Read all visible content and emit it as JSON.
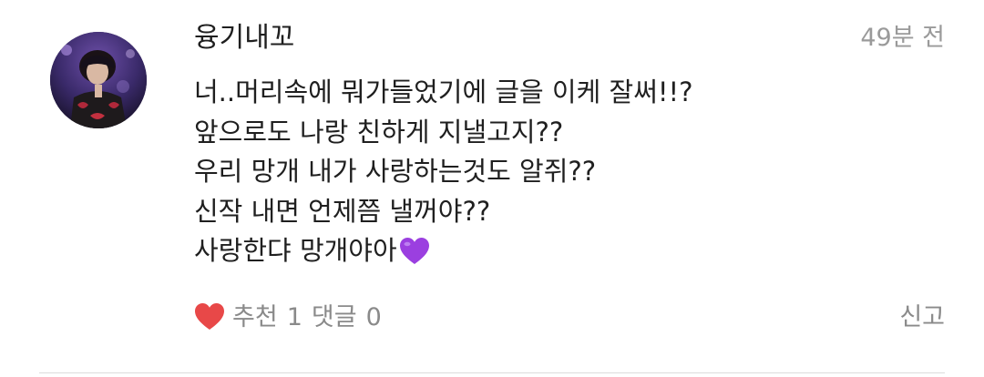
{
  "comment": {
    "username": "융기내꼬",
    "timestamp": "49분 전",
    "lines": [
      "너..머리속에 뭐가들었기에 글을 이케 잘써!!?",
      "앞으로도 나랑 친하게 지낼고지??",
      "우리 망개 내가 사랑하는것도 알쥐??",
      "신작 내면 언제쯤 낼꺼야??",
      "사랑한댜 망개야아"
    ],
    "emoji": "purple-heart",
    "like_label": "추천",
    "like_count": "1",
    "reply_label": "댓글",
    "reply_count": "0",
    "report_label": "신고"
  },
  "colors": {
    "like_heart": "#e84848",
    "purple_heart": "#9b3fe0",
    "muted_text": "#8a8a8a",
    "timestamp": "#9a9a9a",
    "main_text": "#1f1f1f"
  },
  "icons": {
    "avatar": "profile-photo",
    "like": "heart-icon",
    "emoji": "purple-heart-emoji"
  }
}
